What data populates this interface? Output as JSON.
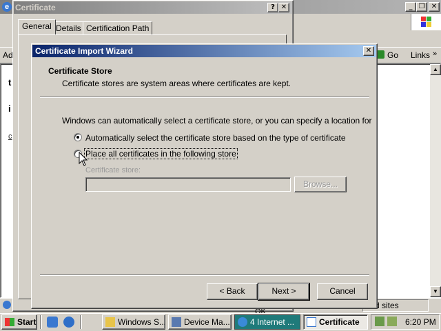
{
  "browser": {
    "menu_icon": "ie-icon",
    "partial_left_labels": [
      "Ad",
      "t",
      "i",
      "c"
    ],
    "go_label": "Go",
    "links_label": "Links",
    "status_right_text": "d sites"
  },
  "cert_dialog": {
    "title": "Certificate",
    "tabs": [
      "General",
      "Details",
      "Certification Path"
    ],
    "ok_partial": "OK"
  },
  "wizard": {
    "title": "Certificate Import Wizard",
    "heading": "Certificate Store",
    "subheading": "Certificate stores are system areas where certificates are kept.",
    "intro": "Windows can automatically select a certificate store, or you can specify a location for",
    "option_auto": "Automatically select the certificate store based on the type of certificate",
    "option_manual": "Place all certificates in the following store",
    "store_label": "Certificate store:",
    "store_value": "",
    "browse_label": "Browse...",
    "back_label": "< Back",
    "next_label": "Next >",
    "cancel_label": "Cancel",
    "selected_option": "auto"
  },
  "taskbar": {
    "start_label": "Start",
    "items": [
      {
        "label": "Windows S...",
        "icon": "folder-icon"
      },
      {
        "label": "Device Ma...",
        "icon": "computer-icon"
      },
      {
        "label": "4 Internet ...",
        "icon": "ie-icon"
      },
      {
        "label": "Certificate",
        "icon": "certificate-icon"
      }
    ],
    "time": "6:20 PM"
  },
  "colors": {
    "desktop": "#d4d0c8",
    "active_title": "#0a246a",
    "taskbar_active": "#1f7a7a"
  }
}
